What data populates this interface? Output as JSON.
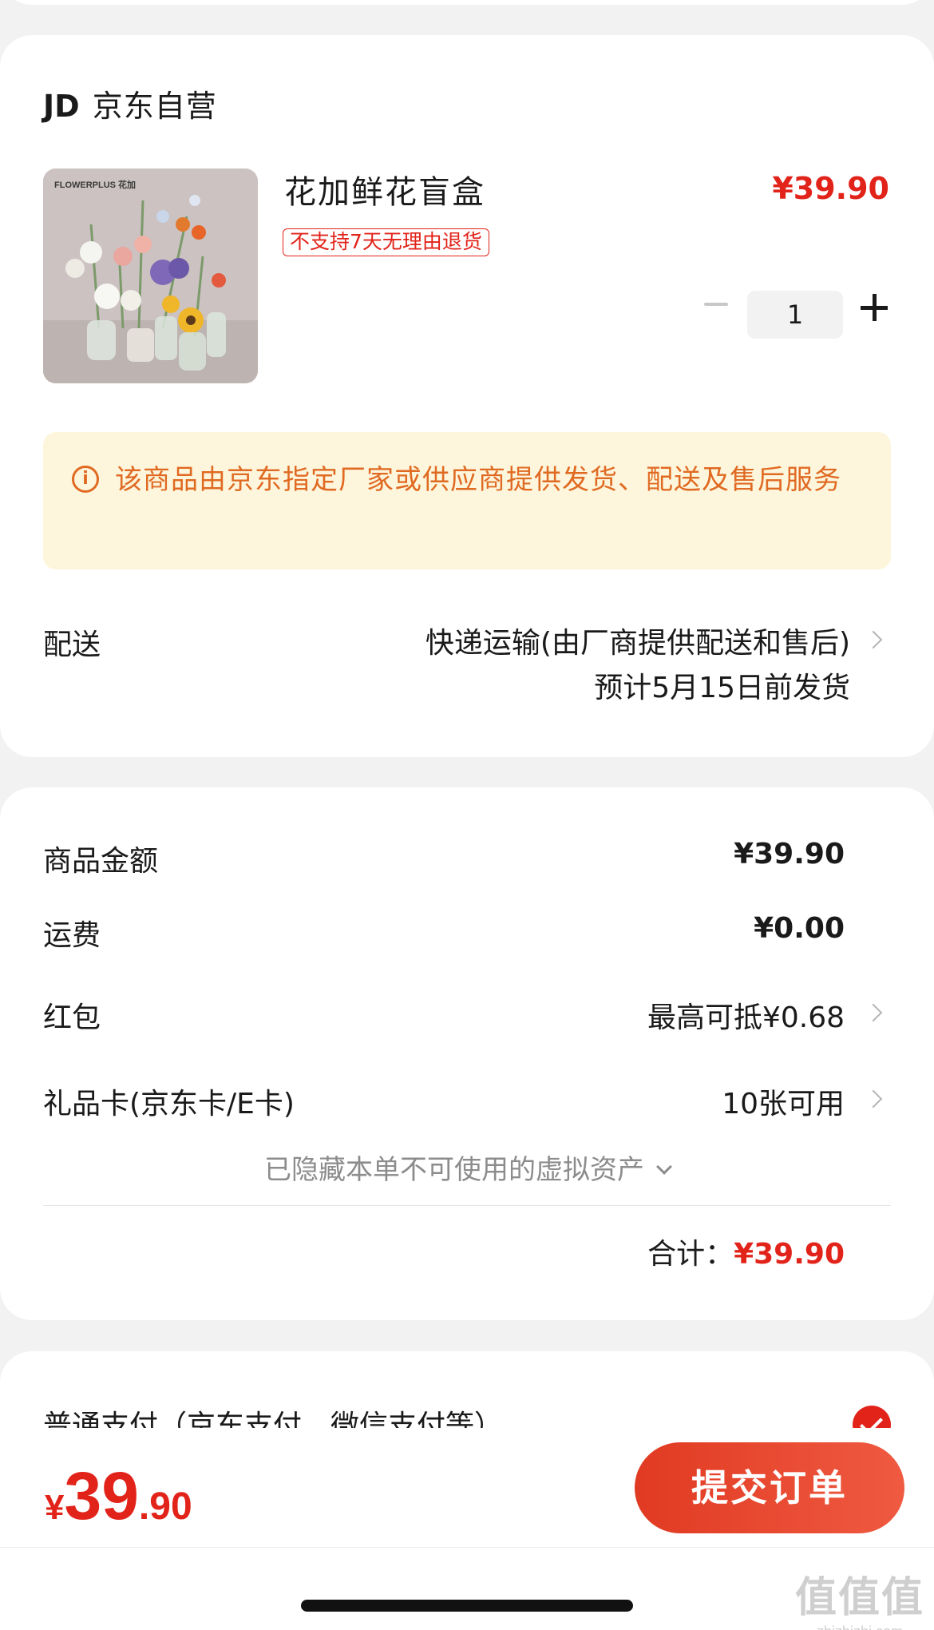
{
  "store": {
    "logo": "JD",
    "name": "京东自营"
  },
  "product": {
    "image_brand": "FLOWERPLUS 花加",
    "name": "花加鲜花盲盒",
    "return_policy_tag": "不支持7天无理由退货",
    "price": "¥39.90",
    "quantity": "1"
  },
  "notice": {
    "icon": "info-icon",
    "text": "该商品由京东指定厂家或供应商提供发货、配送及售后服务"
  },
  "delivery": {
    "label": "配送",
    "method": "快递运输(由厂商提供配送和售后)",
    "estimate": "预计5月15日前发货"
  },
  "summary": {
    "goods_amount_label": "商品金额",
    "goods_amount": "¥39.90",
    "shipping_label": "运费",
    "shipping": "¥0.00",
    "red_packet_label": "红包",
    "red_packet": "最高可抵¥0.68",
    "gift_card_label": "礼品卡(京东卡/E卡)",
    "gift_card": "10张可用",
    "hidden_assets": "已隐藏本单不可使用的虚拟资产",
    "total_label": "合计：",
    "total": "¥39.90"
  },
  "payment": {
    "method_label": "普通支付（京东支付、微信支付等）"
  },
  "bottom_bar": {
    "currency": "¥",
    "price_int": "39",
    "price_dec": ".90",
    "submit_label": "提交订单"
  },
  "watermark": {
    "big": "值值值",
    "small": "zhizhizhi.com"
  },
  "colors": {
    "accent": "#e2231a",
    "notice_bg": "#fdf6dc",
    "notice_text": "#e06a22",
    "page_bg": "#f2f2f2"
  }
}
